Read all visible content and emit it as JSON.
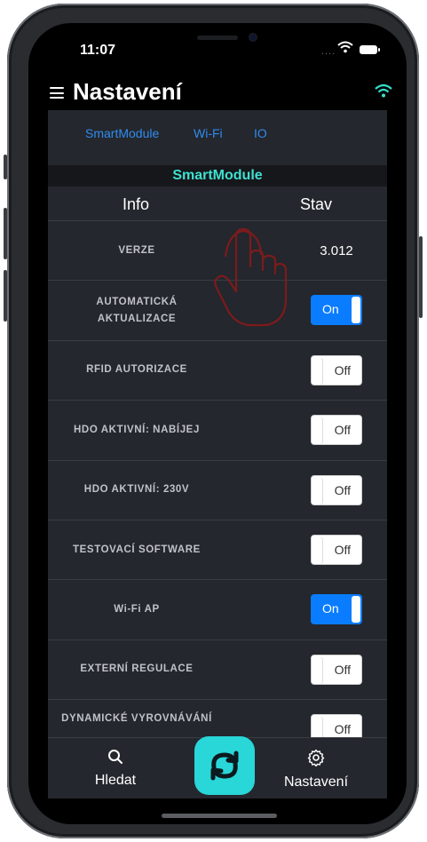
{
  "status_bar": {
    "time": "11:07",
    "signal": "....",
    "wifi_icon": "wifi-icon",
    "battery_icon": "battery-icon"
  },
  "header": {
    "title": "Nastavení",
    "menu_icon": "hamburger-menu-icon",
    "connection_icon": "wifi-icon",
    "connection_color": "#34e0c8"
  },
  "tabs": [
    {
      "label": "SmartModule"
    },
    {
      "label": "Wi-Fi"
    },
    {
      "label": "IO"
    }
  ],
  "section": {
    "title": "SmartModule"
  },
  "columns": {
    "info": "Info",
    "state": "Stav"
  },
  "rows": [
    {
      "label": "VERZE",
      "value": "3.012"
    },
    {
      "label": "AUTOMATICKÁ AKTUALIZACE",
      "toggle": "On"
    },
    {
      "label": "RFID AUTORIZACE",
      "toggle": "Off"
    },
    {
      "label": "HDO AKTIVNÍ: NABÍJEJ",
      "toggle": "Off"
    },
    {
      "label": "HDO AKTIVNÍ: 230V",
      "toggle": "Off"
    },
    {
      "label": "TESTOVACÍ SOFTWARE",
      "toggle": "Off"
    },
    {
      "label": "Wi-Fi AP",
      "toggle": "On"
    },
    {
      "label": "EXTERNÍ REGULACE",
      "toggle": "Off"
    },
    {
      "label": "DYNAMICKÉ VYROVNÁVÁNÍ",
      "toggle": "Off"
    }
  ],
  "tabbar": {
    "search": {
      "label": "Hledat",
      "icon": "search-icon"
    },
    "refresh": {
      "icon": "refresh-icon",
      "color": "#29d6d8"
    },
    "settings": {
      "label": "Nastavení",
      "icon": "gear-icon"
    }
  },
  "colors": {
    "accent": "#2f8cf0",
    "toggle_on": "#0a7cff",
    "section_title": "#3fe0cf",
    "background": "#24272d"
  },
  "overlay": {
    "icon": "tap-hand-icon",
    "color": "#8b1a1a"
  }
}
